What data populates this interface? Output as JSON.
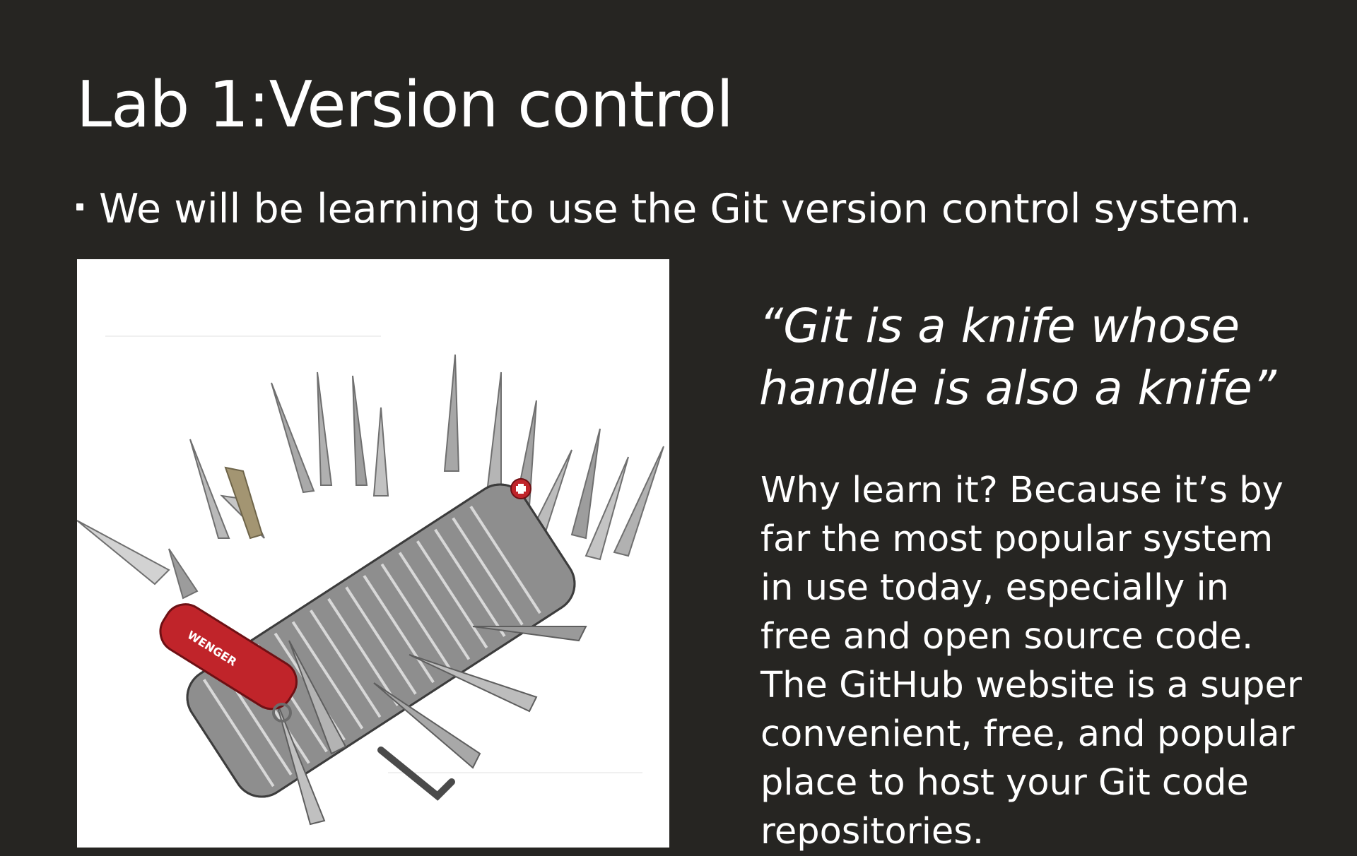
{
  "slide": {
    "title": "Lab 1:Version control",
    "bullet": "We will be learning to use the Git version control system.",
    "quote_line1": "“Git is a knife whose",
    "quote_line2": "handle is also a knife”",
    "body": "Why learn it? Because it’s by far the most popular system in use today, especially in free and open source code. The GitHub website is a super convenient, free, and popular place to host your Git code repositories."
  },
  "image": {
    "icon": "multi-tool-swiss-army-knife-icon",
    "brand_label": "WENGER"
  },
  "colors": {
    "background": "#262522",
    "text": "#ffffff",
    "knife_handle": "#c0242a"
  }
}
